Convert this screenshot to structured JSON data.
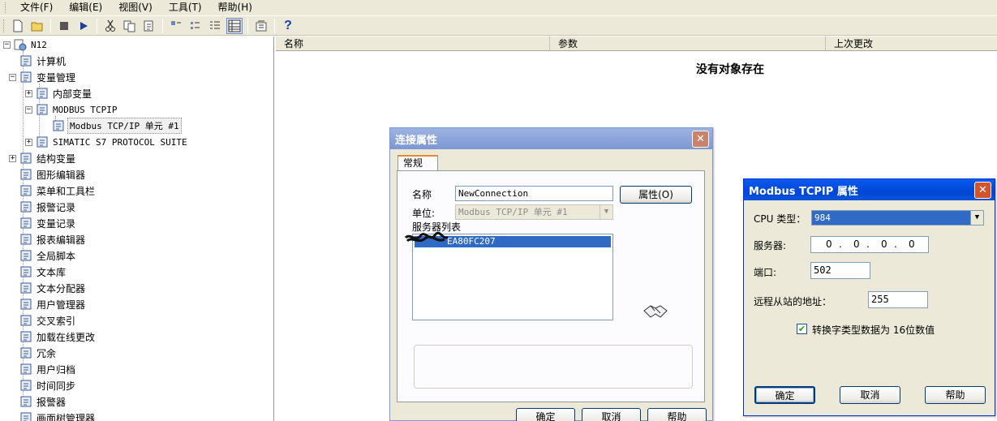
{
  "menubar": [
    "文件(F)",
    "编辑(E)",
    "视图(V)",
    "工具(T)",
    "帮助(H)"
  ],
  "toolbar": {
    "help_glyph": "?"
  },
  "tree": {
    "root": "N12",
    "items": [
      {
        "label": "计算机",
        "icon": "computer-icon"
      },
      {
        "label": "变量管理",
        "icon": "tag-management-icon"
      },
      {
        "label": "内部变量",
        "icon": "internal-tags-icon"
      },
      {
        "label": "MODBUS TCPIP",
        "icon": "driver-icon"
      },
      {
        "label": "Modbus TCP/IP 单元 #1",
        "icon": "unit-icon"
      },
      {
        "label": "SIMATIC S7 PROTOCOL SUITE",
        "icon": "driver-icon"
      },
      {
        "label": "结构变量",
        "icon": "structure-tags-icon"
      },
      {
        "label": "图形编辑器",
        "icon": "graphics-designer-icon"
      },
      {
        "label": "菜单和工具栏",
        "icon": "menus-toolbars-icon"
      },
      {
        "label": "报警记录",
        "icon": "alarm-logging-icon"
      },
      {
        "label": "变量记录",
        "icon": "tag-logging-icon"
      },
      {
        "label": "报表编辑器",
        "icon": "report-designer-icon"
      },
      {
        "label": "全局脚本",
        "icon": "global-script-icon"
      },
      {
        "label": "文本库",
        "icon": "text-library-icon"
      },
      {
        "label": "文本分配器",
        "icon": "text-distributor-icon"
      },
      {
        "label": "用户管理器",
        "icon": "user-administrator-icon"
      },
      {
        "label": "交叉索引",
        "icon": "cross-reference-icon"
      },
      {
        "label": "加载在线更改",
        "icon": "load-online-changes-icon"
      },
      {
        "label": "冗余",
        "icon": "redundancy-icon"
      },
      {
        "label": "用户归档",
        "icon": "user-archive-icon"
      },
      {
        "label": "时间同步",
        "icon": "time-sync-icon"
      },
      {
        "label": "报警器",
        "icon": "horn-icon"
      },
      {
        "label": "画面树管理器",
        "icon": "picture-tree-icon"
      }
    ]
  },
  "list": {
    "columns": [
      "名称",
      "参数",
      "上次更改"
    ],
    "empty_message": "没有对象存在"
  },
  "connection_dialog": {
    "title": "连接属性",
    "tab": "常规",
    "name_label": "名称",
    "name_value": "NewConnection",
    "properties_button": "属性(O)",
    "unit_label": "单位:",
    "unit_value": "Modbus TCP/IP 单元 #1",
    "server_list_label": "服务器列表",
    "server_item": "EA80FC207",
    "ok": "确定",
    "cancel": "取消",
    "help": "帮助"
  },
  "modbus_dialog": {
    "title": "Modbus TCPIP 属性",
    "cpu_label": "CPU 类型：",
    "cpu_value": "984",
    "server_label": "服务器:",
    "ip_octets": [
      "0",
      "0",
      "0",
      "0"
    ],
    "port_label": "端口:",
    "port_value": "502",
    "slave_label": "远程从站的地址：",
    "slave_value": "255",
    "convert_label": "转换字类型数据为 16位数值",
    "convert_checked": true,
    "ok": "确定",
    "cancel": "取消",
    "help": "帮助"
  },
  "colors": {
    "selection": "#316ac5",
    "title_active": "#0146d6",
    "dialog_bg": "#ece9d8"
  }
}
